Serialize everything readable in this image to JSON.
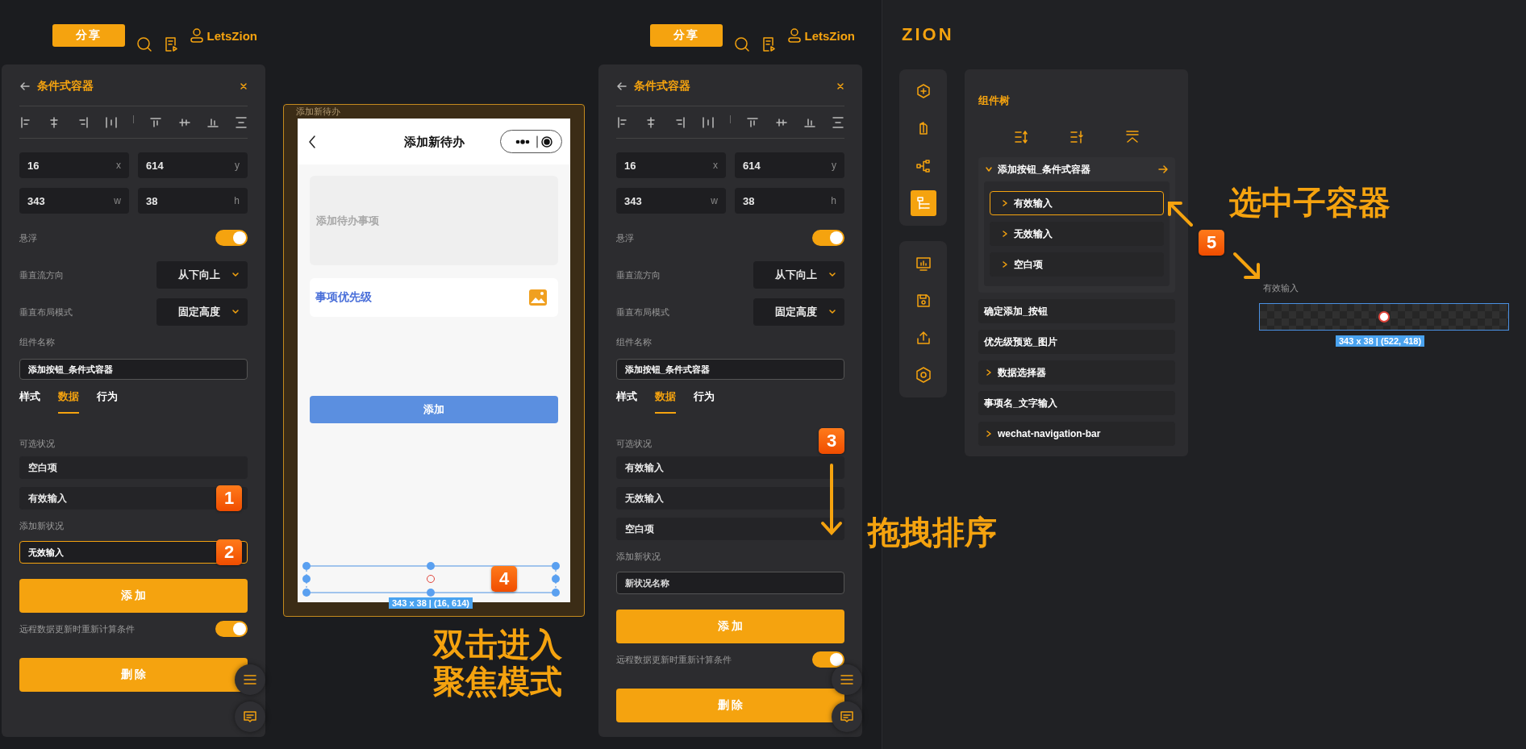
{
  "editors": [
    {
      "toolbar": {
        "share": "分享",
        "user": "LetsZion"
      },
      "panel": {
        "title": "条件式容器",
        "fields": [
          {
            "value": "16",
            "unit": "x"
          },
          {
            "value": "614",
            "unit": "y"
          },
          {
            "value": "343",
            "unit": "w"
          },
          {
            "value": "38",
            "unit": "h"
          }
        ],
        "float_toggle": {
          "label": "悬浮",
          "on": true
        },
        "selects": [
          {
            "label": "垂直流方向",
            "value": "从下向上"
          },
          {
            "label": "垂直布局模式",
            "value": "固定高度"
          }
        ],
        "name_label": "组件名称",
        "name_value": "添加按钮_条件式容器",
        "tabs": [
          {
            "label": "样式",
            "selected": false
          },
          {
            "label": "数据",
            "selected": true
          },
          {
            "label": "行为",
            "selected": false
          }
        ],
        "states_label": "可选状况",
        "states": [
          {
            "label": "空白项"
          },
          {
            "label": "有效输入",
            "badge": "1"
          }
        ],
        "new_state_label": "添加新状况",
        "new_state": {
          "value": "无效输入",
          "focused": true,
          "badge": "2"
        },
        "add_button": "添 加",
        "recompute_toggle": {
          "label": "远程数据更新时重新计算条件",
          "on": true
        },
        "delete_button": "删 除"
      }
    },
    {
      "toolbar": {
        "share": "分享",
        "user": "LetsZion"
      },
      "panel": {
        "title": "条件式容器",
        "fields": [
          {
            "value": "16",
            "unit": "x"
          },
          {
            "value": "614",
            "unit": "y"
          },
          {
            "value": "343",
            "unit": "w"
          },
          {
            "value": "38",
            "unit": "h"
          }
        ],
        "float_toggle": {
          "label": "悬浮",
          "on": true
        },
        "selects": [
          {
            "label": "垂直流方向",
            "value": "从下向上"
          },
          {
            "label": "垂直布局模式",
            "value": "固定高度"
          }
        ],
        "name_label": "组件名称",
        "name_value": "添加按钮_条件式容器",
        "tabs": [
          {
            "label": "样式",
            "selected": false
          },
          {
            "label": "数据",
            "selected": true
          },
          {
            "label": "行为",
            "selected": false
          }
        ],
        "states_label": "可选状况",
        "states_badge": "3",
        "states": [
          {
            "label": "有效输入"
          },
          {
            "label": "无效输入"
          },
          {
            "label": "空白项"
          }
        ],
        "new_state_label": "添加新状况",
        "new_state": {
          "placeholder": "新状况名称",
          "focused": false
        },
        "add_button": "添 加",
        "recompute_toggle": {
          "label": "远程数据更新时重新计算条件",
          "on": true
        },
        "delete_button": "删 除"
      }
    }
  ],
  "phone": {
    "frame_label": "添加新待办",
    "nav_title": "添加新待办",
    "input_placeholder": "添加待办事项",
    "priority_label": "事项优先级",
    "button": "添加",
    "selection": {
      "size_label": "343 x 38 | (16, 614)",
      "badge": "4"
    }
  },
  "annotations": {
    "focus_hint": [
      "双击进入",
      "聚焦模式"
    ],
    "drag_hint": "拖拽排序",
    "select_hint": "选中子容器"
  },
  "logo": "ZION",
  "rail_groups": [
    [
      {
        "kind": "component",
        "selected": false
      },
      {
        "kind": "pages",
        "selected": false
      },
      {
        "kind": "flow",
        "selected": false
      },
      {
        "kind": "tree",
        "selected": true
      }
    ],
    [
      {
        "kind": "dashboard",
        "selected": false
      },
      {
        "kind": "save",
        "selected": false
      },
      {
        "kind": "upload",
        "selected": false
      },
      {
        "kind": "settings",
        "selected": false
      }
    ]
  ],
  "tree": {
    "title": "组件树",
    "items": [
      {
        "label": "添加按钮_条件式容器",
        "kind": "group",
        "expanded": true,
        "selected": false,
        "children": [
          {
            "label": "有效输入",
            "kind": "group",
            "expanded": false,
            "selected": true
          },
          {
            "label": "无效输入",
            "kind": "group",
            "expanded": false,
            "selected": false
          },
          {
            "label": "空白项",
            "kind": "group",
            "expanded": false,
            "selected": false
          }
        ]
      },
      {
        "label": "确定添加_按钮",
        "kind": "leaf",
        "selected": false
      },
      {
        "label": "优先级预览_图片",
        "kind": "leaf",
        "selected": false
      },
      {
        "label": "数据选择器",
        "kind": "group",
        "expanded": false,
        "selected": false
      },
      {
        "label": "事项名_文字输入",
        "kind": "leaf",
        "selected": false
      },
      {
        "label": "wechat-navigation-bar",
        "kind": "group",
        "expanded": false,
        "selected": false
      }
    ]
  },
  "preview": {
    "badge": "5",
    "label": "有效输入",
    "size_label": "343 x 38 | (522, 418)"
  }
}
